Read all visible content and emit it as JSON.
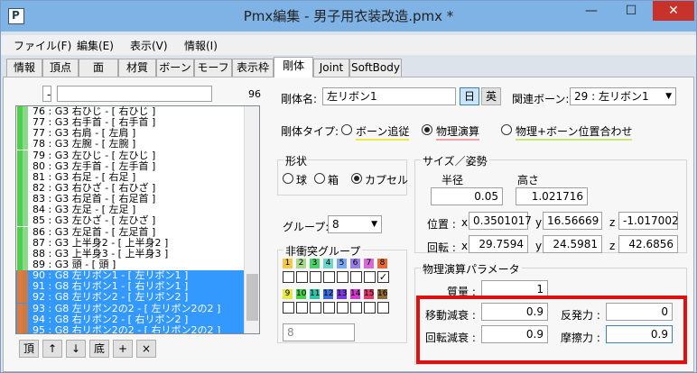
{
  "window": {
    "title": "Pmx編集 - 男子用衣装改造.pmx *",
    "icon_text": "P",
    "minimize": "—",
    "maximize": "☐",
    "close": "✕"
  },
  "menu": [
    "ファイル(F)",
    "編集(E)",
    "表示(V)",
    "情報(I)"
  ],
  "tabs": [
    "情報",
    "頂点",
    "面",
    "材質",
    "ボーン",
    "モーフ",
    "表示枠",
    "剛体",
    "Joint",
    "SoftBody"
  ],
  "active_tab": "剛体",
  "list": {
    "filter_value": "-",
    "search_value": "",
    "count": "96",
    "rows": [
      {
        "text": "76 : G3 右ひじ - [ 右ひじ ]",
        "selected": false
      },
      {
        "text": "77 : G3 右手首 - [ 右手首 ]",
        "selected": false
      },
      {
        "text": "77 : G3 右肩 - [ 左肩 ]",
        "selected": false
      },
      {
        "text": "78 : G3 左腕 - [ 左腕 ]",
        "selected": false
      },
      {
        "text": "79 : G3 左ひじ - [ 左ひじ ]",
        "selected": false
      },
      {
        "text": "80 : G3 左手首 - [ 左手首 ]",
        "selected": false
      },
      {
        "text": "81 : G3 右足 - [ 右足 ]",
        "selected": false
      },
      {
        "text": "82 : G3 右ひざ - [ 右ひざ ]",
        "selected": false
      },
      {
        "text": "83 : G3 右足首 - [ 右足首 ]",
        "selected": false
      },
      {
        "text": "84 : G3 左足 - [ 左足 ]",
        "selected": false
      },
      {
        "text": "85 : G3 左ひざ - [ 左ひざ ]",
        "selected": false
      },
      {
        "text": "86 : G3 左足首 - [ 左足首 ]",
        "selected": false
      },
      {
        "text": "87 : G3 上半身2 - [ 上半身2 ]",
        "selected": false
      },
      {
        "text": "88 : G3 上半身3 - [ 上半身3 ]",
        "selected": false
      },
      {
        "text": "89 : G3 頭 - [ 頭 ]",
        "selected": false
      },
      {
        "text": "90 : G8 左リボン1 - [ 左リボン1 ]",
        "selected": true
      },
      {
        "text": "91 : G8 右リボン1 - [ 右リボン1 ]",
        "selected": true
      },
      {
        "text": "92 : G8 左リボン2 - [ 左リボン2 ]",
        "selected": true
      },
      {
        "text": "93 : G8 左リボン2の2 - [ 左リボン2の2 ]",
        "selected": true
      },
      {
        "text": "94 : G8 右リボン2 - [ 右リボン2 ]",
        "selected": true
      },
      {
        "text": "95 : G8 右リボン2の2 - [ 右リボン2の2 ]",
        "selected": true
      }
    ],
    "buttons": [
      "頂",
      "↑",
      "↓",
      "底",
      "+",
      "×"
    ]
  },
  "body": {
    "name_label": "剛体名:",
    "name_value": "左リボン1",
    "lang_jp": "日",
    "lang_en": "英",
    "bone_label": "関連ボーン:",
    "bone_value": "29 : 左リボン1",
    "type_label": "剛体タイプ:",
    "type_options": [
      "ボーン追従",
      "物理演算",
      "物理+ボーン位置合わせ"
    ],
    "type_selected": 1,
    "shape_title": "形状",
    "shape_options": [
      "球",
      "箱",
      "カプセル"
    ],
    "shape_selected": 2,
    "group_label": "グループ:",
    "group_value": "8",
    "nocollide_title": "非衝突グループ",
    "groups_row1": [
      "1",
      "2",
      "3",
      "4",
      "5",
      "6",
      "7",
      "8"
    ],
    "groups_row2": [
      "9",
      "10",
      "11",
      "12",
      "13",
      "14",
      "15",
      "16"
    ],
    "group_colors_row1": [
      "#f5c84b",
      "#a8d88a",
      "#4bd06b",
      "#6ad7c8",
      "#7ba6f0",
      "#9a7ee8",
      "#d86ad8",
      "#e86a3a"
    ],
    "group_colors_row2": [
      "#e8e84b",
      "#4bd04b",
      "#2ec4a8",
      "#3a6ae0",
      "#7a3ae0",
      "#d03ad0",
      "#e03a6a",
      "#8a6a3a"
    ],
    "checked_row1": 7,
    "nocollide_value": "8",
    "size_title": "サイズ／姿勢",
    "radius_label": "半径",
    "height_label": "高さ",
    "radius_value": "0.05",
    "height_value": "1.021716",
    "pos_label": "位置 :",
    "rot_label": "回転 :",
    "axis_x": "x",
    "axis_y": "y",
    "axis_z": "z",
    "pos": [
      "0.3501017",
      "16.56669",
      "-1.017002"
    ],
    "rot": [
      "29.7594",
      "24.5981",
      "42.6856"
    ],
    "phys_title": "物理演算パラメータ",
    "mass_label": "質量 :",
    "mass_value": "1",
    "lin_damp_label": "移動減衰 :",
    "lin_damp_value": "0.9",
    "rot_damp_label": "回転減衰 :",
    "rot_damp_value": "0.9",
    "restitution_label": "反発力 :",
    "restitution_value": "0",
    "friction_label": "摩擦力 :",
    "friction_value": "0.9"
  }
}
